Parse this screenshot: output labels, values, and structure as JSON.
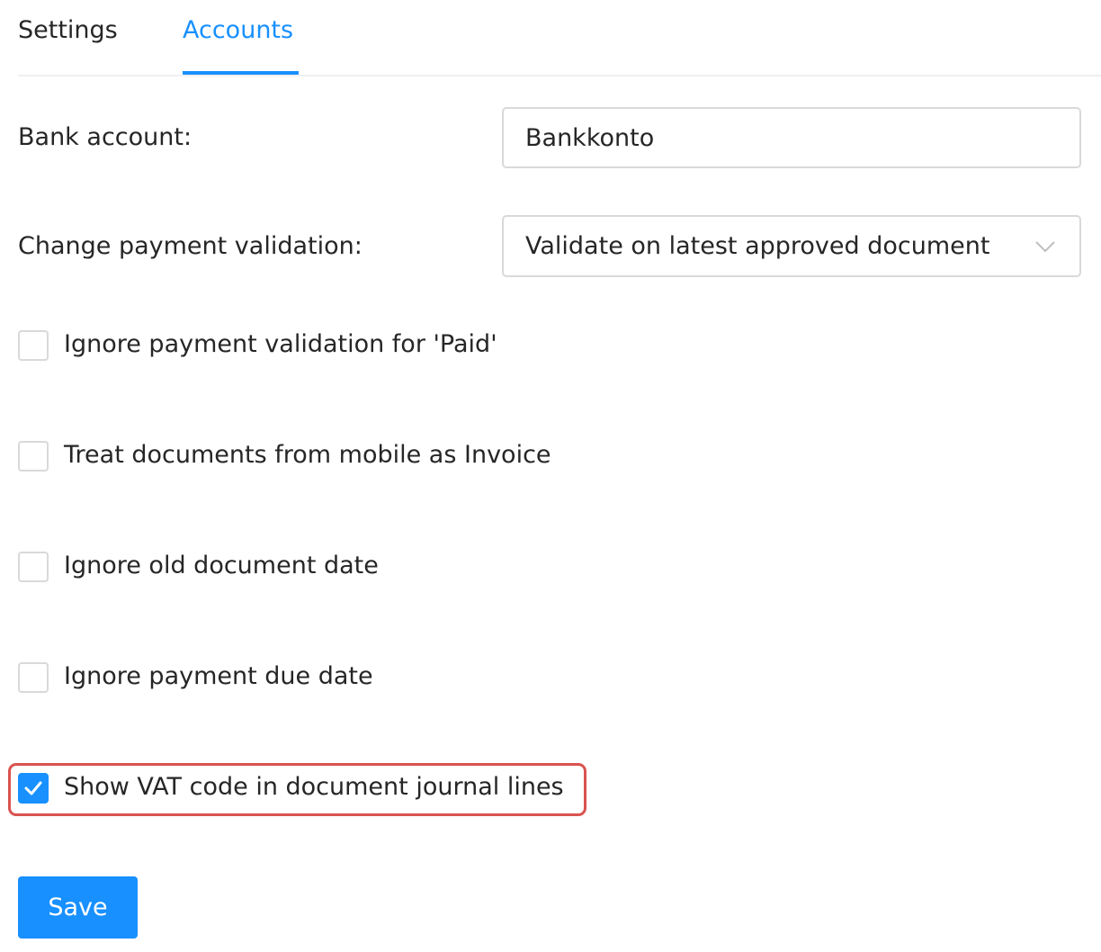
{
  "tabs": {
    "settings": "Settings",
    "accounts": "Accounts",
    "active": "Accounts"
  },
  "bank_account": {
    "label": "Bank account:",
    "value": "Bankkonto"
  },
  "change_payment_validation": {
    "label": "Change payment validation:",
    "selected": "Validate on latest approved document"
  },
  "checkboxes": [
    {
      "label": "Ignore payment validation for 'Paid'",
      "checked": false
    },
    {
      "label": "Treat documents from mobile as Invoice",
      "checked": false
    },
    {
      "label": "Ignore old document date",
      "checked": false
    },
    {
      "label": "Ignore payment due date",
      "checked": false
    },
    {
      "label": "Show VAT code in document journal lines",
      "checked": true
    }
  ],
  "save_label": "Save",
  "colors": {
    "accent": "#1890ff",
    "highlight": "#d9534f",
    "border": "#d9d9d9"
  }
}
